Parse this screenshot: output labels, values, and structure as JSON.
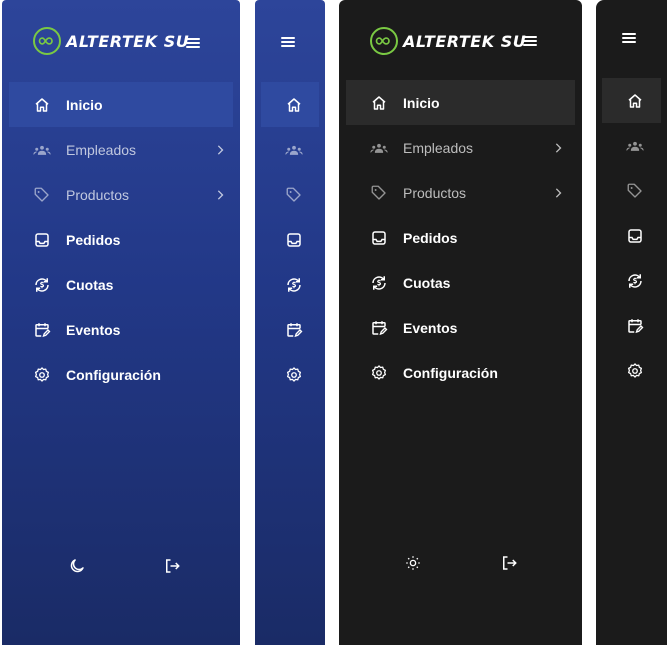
{
  "brand": {
    "name": "ALTERTEK SU",
    "accent": "#7ac943"
  },
  "menu": {
    "items": [
      {
        "label": "Inicio",
        "icon": "home-icon"
      },
      {
        "label": "Empleados",
        "icon": "users-icon"
      },
      {
        "label": "Productos",
        "icon": "tag-icon"
      },
      {
        "label": "Pedidos",
        "icon": "inbox-icon"
      },
      {
        "label": "Cuotas",
        "icon": "refresh-dollar-icon"
      },
      {
        "label": "Eventos",
        "icon": "calendar-edit-icon"
      },
      {
        "label": "Configuración",
        "icon": "gear-icon"
      }
    ]
  },
  "footer": {
    "theme_light": "moon-icon",
    "theme_dark": "sun-icon",
    "logout": "logout-icon"
  },
  "colors": {
    "blue_top": "#2d459a",
    "blue_bottom": "#1a2b66",
    "dark_bg": "#1b1b1b",
    "active_blue": "#2f4aa0",
    "active_dark": "#2b2b2b"
  }
}
